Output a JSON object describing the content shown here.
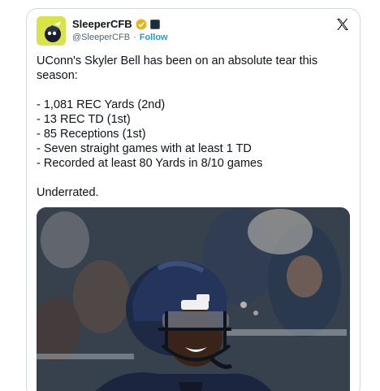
{
  "account": {
    "display_name": "SleeperCFB",
    "handle": "@SleeperCFB",
    "separator": "·",
    "follow_label": "Follow"
  },
  "tweet": {
    "line1": "UConn's Skyler Bell has been on an absolute tear this",
    "line2": "season:",
    "stats": [
      "- 1,081 REC Yards (2nd)",
      "- 13 REC TD (1st)",
      "- 85 Receptions (1st)",
      "- Seven straight games with at least 1 TD",
      "- Recorded at least 80 Yards in 8/10 games"
    ],
    "closing": "Underrated."
  },
  "icons": {
    "verified": "verified-badge-icon",
    "affiliate": "affiliate-badge-icon",
    "x_logo": "x-logo-icon"
  },
  "colors": {
    "link": "#1d9bf0",
    "verified_gold": "#e2b719",
    "secondary_text": "#536471",
    "avatar_bg": "#d9e34a",
    "helmet_navy": "#1e2a44"
  }
}
